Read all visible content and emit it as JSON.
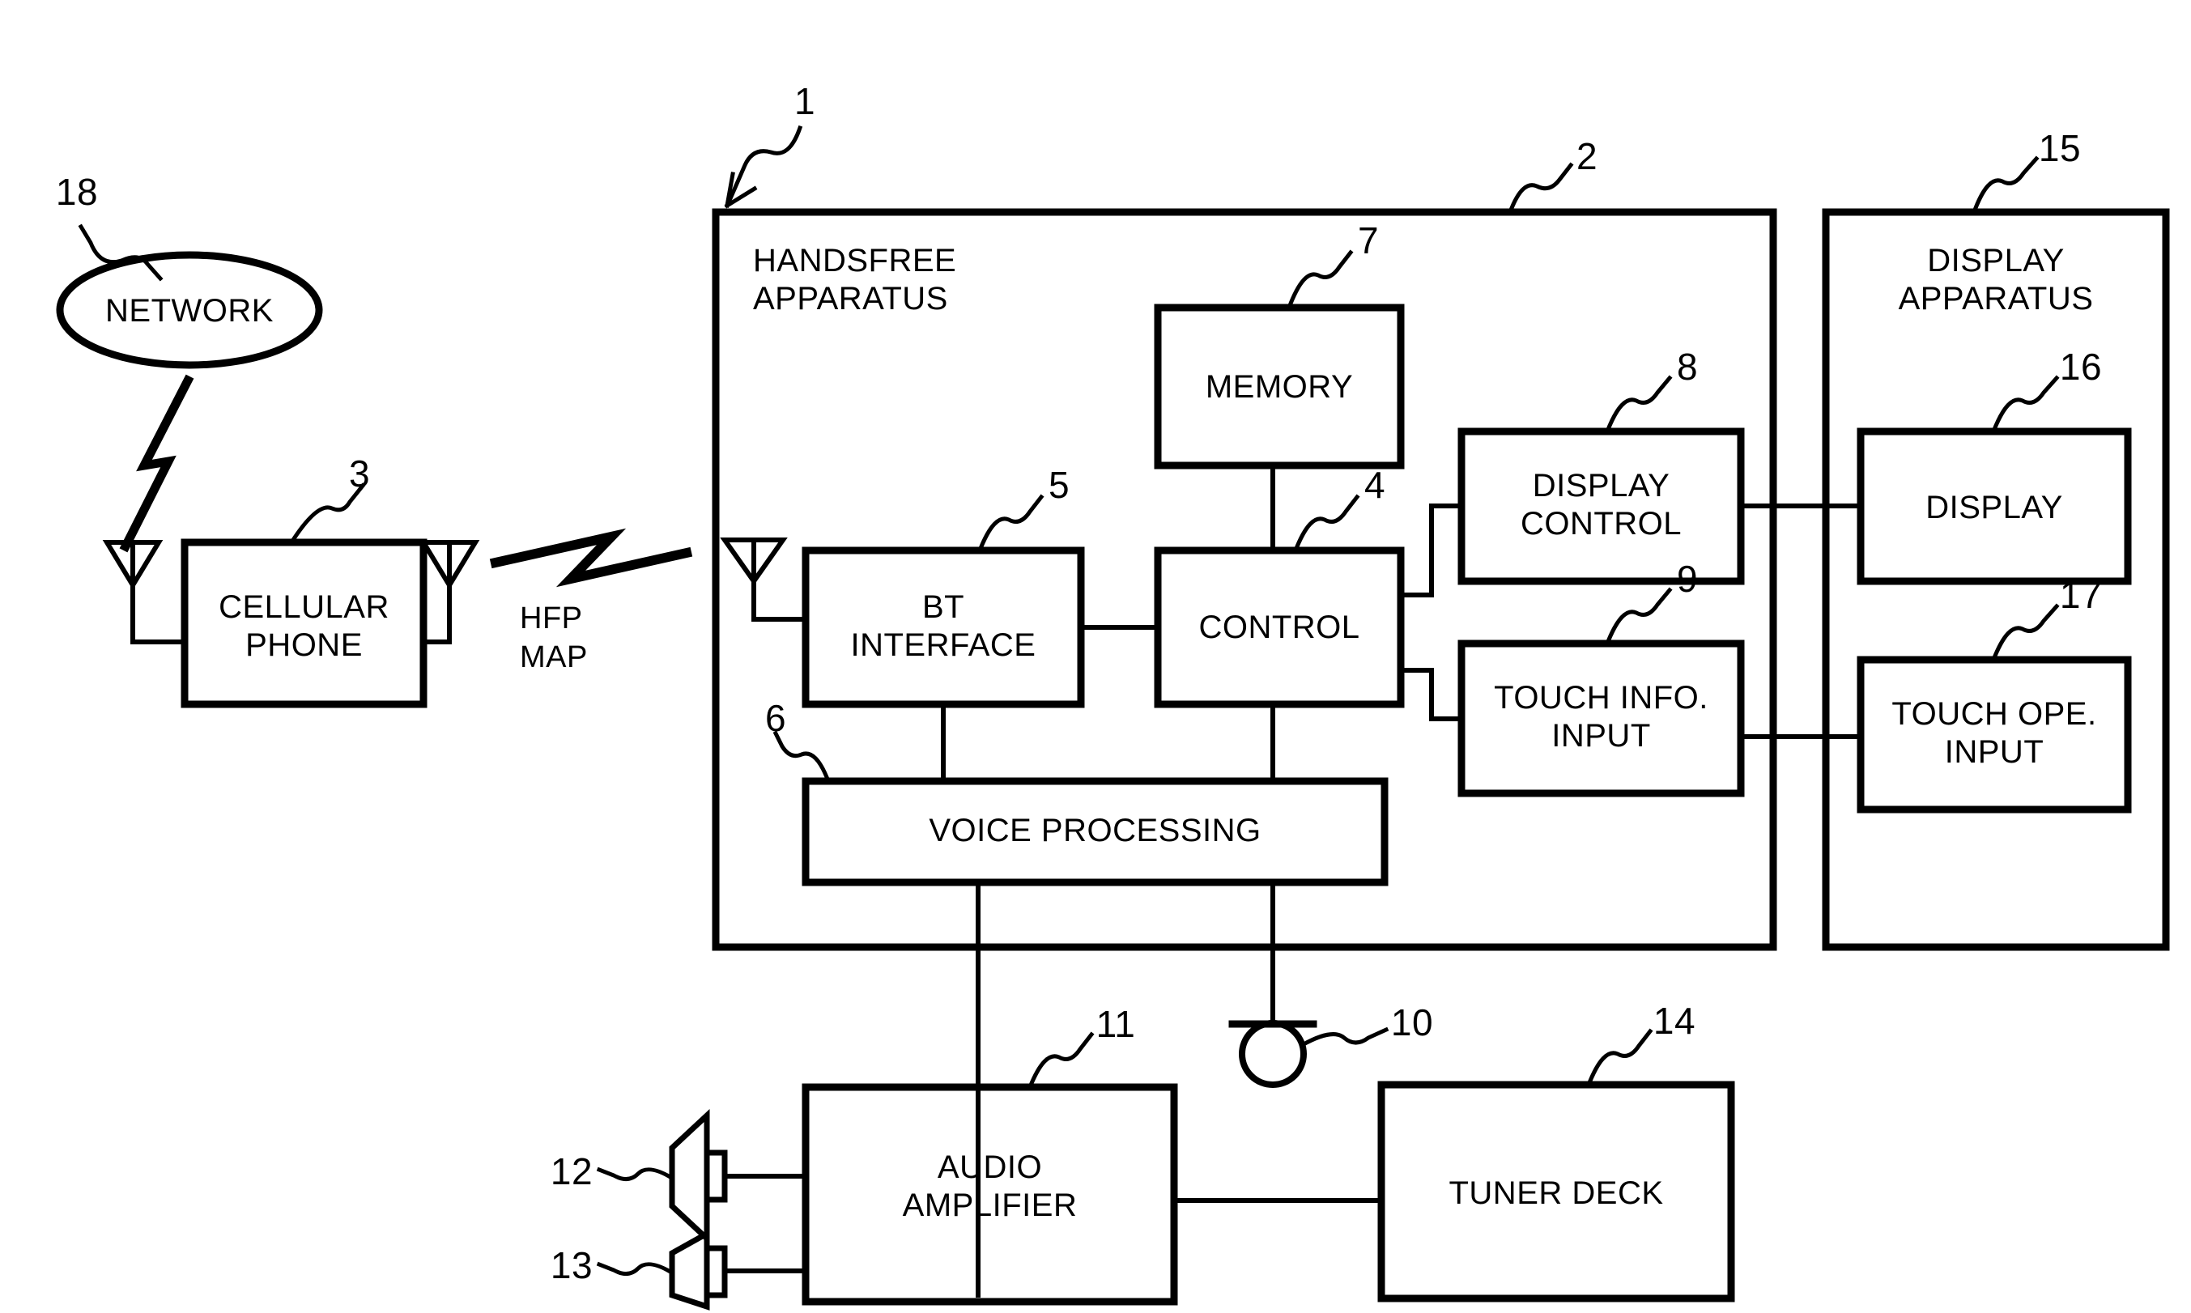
{
  "figure": {
    "type": "patent-block-diagram",
    "background": "#ffffff",
    "stroke": "#000000"
  },
  "nodes": {
    "network": {
      "ref": "18",
      "label": "NETWORK",
      "shape": "ellipse"
    },
    "cellular_phone": {
      "ref": "3",
      "label": "CELLULAR\nPHONE",
      "line1": "CELLULAR",
      "line2": "PHONE",
      "shape": "rect"
    },
    "handsfree_apparatus": {
      "ref": "1",
      "outer_ref": "2",
      "line1": "HANDSFREE",
      "line2": "APPARATUS",
      "shape": "rect"
    },
    "memory": {
      "ref": "7",
      "label": "MEMORY",
      "shape": "rect"
    },
    "bt_interface": {
      "ref": "5",
      "line1": "BT",
      "line2": "INTERFACE",
      "shape": "rect"
    },
    "control": {
      "ref": "4",
      "label": "CONTROL",
      "shape": "rect"
    },
    "voice_processing": {
      "ref": "6",
      "label": "VOICE PROCESSING",
      "shape": "rect"
    },
    "display_control": {
      "ref": "8",
      "line1": "DISPLAY",
      "line2": "CONTROL",
      "shape": "rect"
    },
    "touch_info_input": {
      "ref": "9",
      "line1": "TOUCH INFO.",
      "line2": "INPUT",
      "shape": "rect"
    },
    "display_apparatus": {
      "ref": "15",
      "line1": "DISPLAY",
      "line2": "APPARATUS",
      "shape": "rect"
    },
    "display": {
      "ref": "16",
      "label": "DISPLAY",
      "shape": "rect"
    },
    "touch_ope_input": {
      "ref": "17",
      "line1": "TOUCH OPE.",
      "line2": "INPUT",
      "shape": "rect"
    },
    "microphone": {
      "ref": "10",
      "label": "",
      "shape": "microphone"
    },
    "audio_amplifier": {
      "ref": "11",
      "line1": "AUDIO",
      "line2": "AMPLIFIER",
      "shape": "rect"
    },
    "speaker_left": {
      "ref": "12",
      "label": "",
      "shape": "speaker"
    },
    "speaker_right": {
      "ref": "13",
      "label": "",
      "shape": "speaker"
    },
    "tuner_deck": {
      "ref": "14",
      "label": "TUNER DECK",
      "shape": "rect"
    }
  },
  "protocols": {
    "bluetooth_link": {
      "line1": "HFP",
      "line2": "MAP"
    }
  },
  "reference_numerals": {
    "n1": "1",
    "n2": "2",
    "n3": "3",
    "n4": "4",
    "n5": "5",
    "n6": "6",
    "n7": "7",
    "n8": "8",
    "n9": "9",
    "n10": "10",
    "n11": "11",
    "n12": "12",
    "n13": "13",
    "n14": "14",
    "n15": "15",
    "n16": "16",
    "n17": "17",
    "n18": "18"
  },
  "icons": {
    "antenna_network": "antenna-icon",
    "antenna_phone": "antenna-icon",
    "antenna_bt": "antenna-icon",
    "microphone": "microphone-icon",
    "speaker": "speaker-icon",
    "lightning": "wireless-link-icon",
    "leader_arrow": "leader-arrow-icon"
  }
}
